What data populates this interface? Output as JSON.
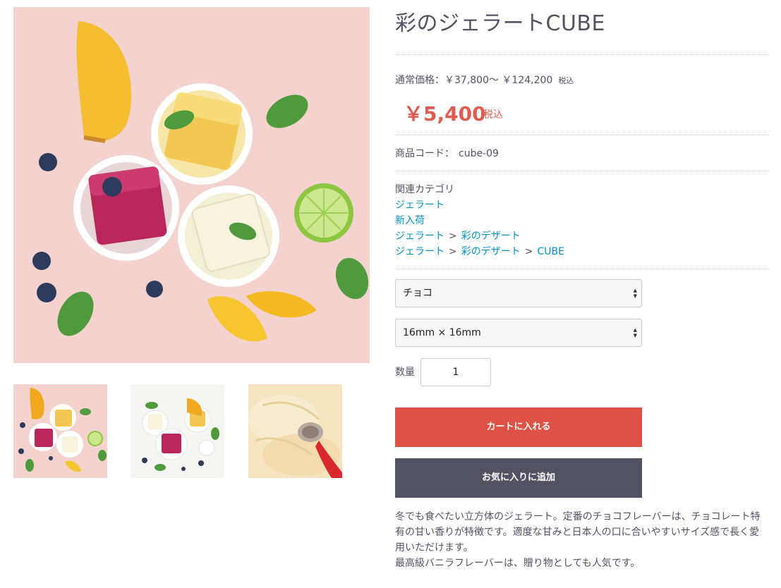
{
  "product": {
    "title": "彩のジェラートCUBE",
    "normal_price_label": "通常価格：",
    "normal_price_range": "￥37,800〜 ￥124,200",
    "normal_price_tax": "税込",
    "sale_price": "￥5,400",
    "sale_price_tax": "税込",
    "code_label": "商品コード：",
    "code_value": "cube-09"
  },
  "categories": {
    "heading": "関連カテゴリ",
    "separator": ">",
    "rows": [
      [
        "ジェラート"
      ],
      [
        "新入荷"
      ],
      [
        "ジェラート",
        "彩のデザート"
      ],
      [
        "ジェラート",
        "彩のデザート",
        "CUBE"
      ]
    ]
  },
  "options": {
    "flavor_selected": "チョコ",
    "size_selected": "16mm × 16mm"
  },
  "quantity": {
    "label": "数量",
    "value": "1"
  },
  "buttons": {
    "add_to_cart": "カートに入れる",
    "add_to_favorite": "お気に入りに追加"
  },
  "description": {
    "paragraph1": "冬でも食べたい立方体のジェラート。定番のチョコフレーバーは、チョコレート特有の甘い香りが特徴です。適度な甘みと日本人の口に合いやすいサイズ感で長く愛用いただけます。",
    "paragraph2": "最高級バニラフレーバーは、贈り物としても人気です。"
  },
  "colors": {
    "accent_red": "#de5246",
    "price_red": "#de5d50",
    "link_blue": "#0092c4",
    "dark_button": "#525263",
    "text": "#525263"
  }
}
